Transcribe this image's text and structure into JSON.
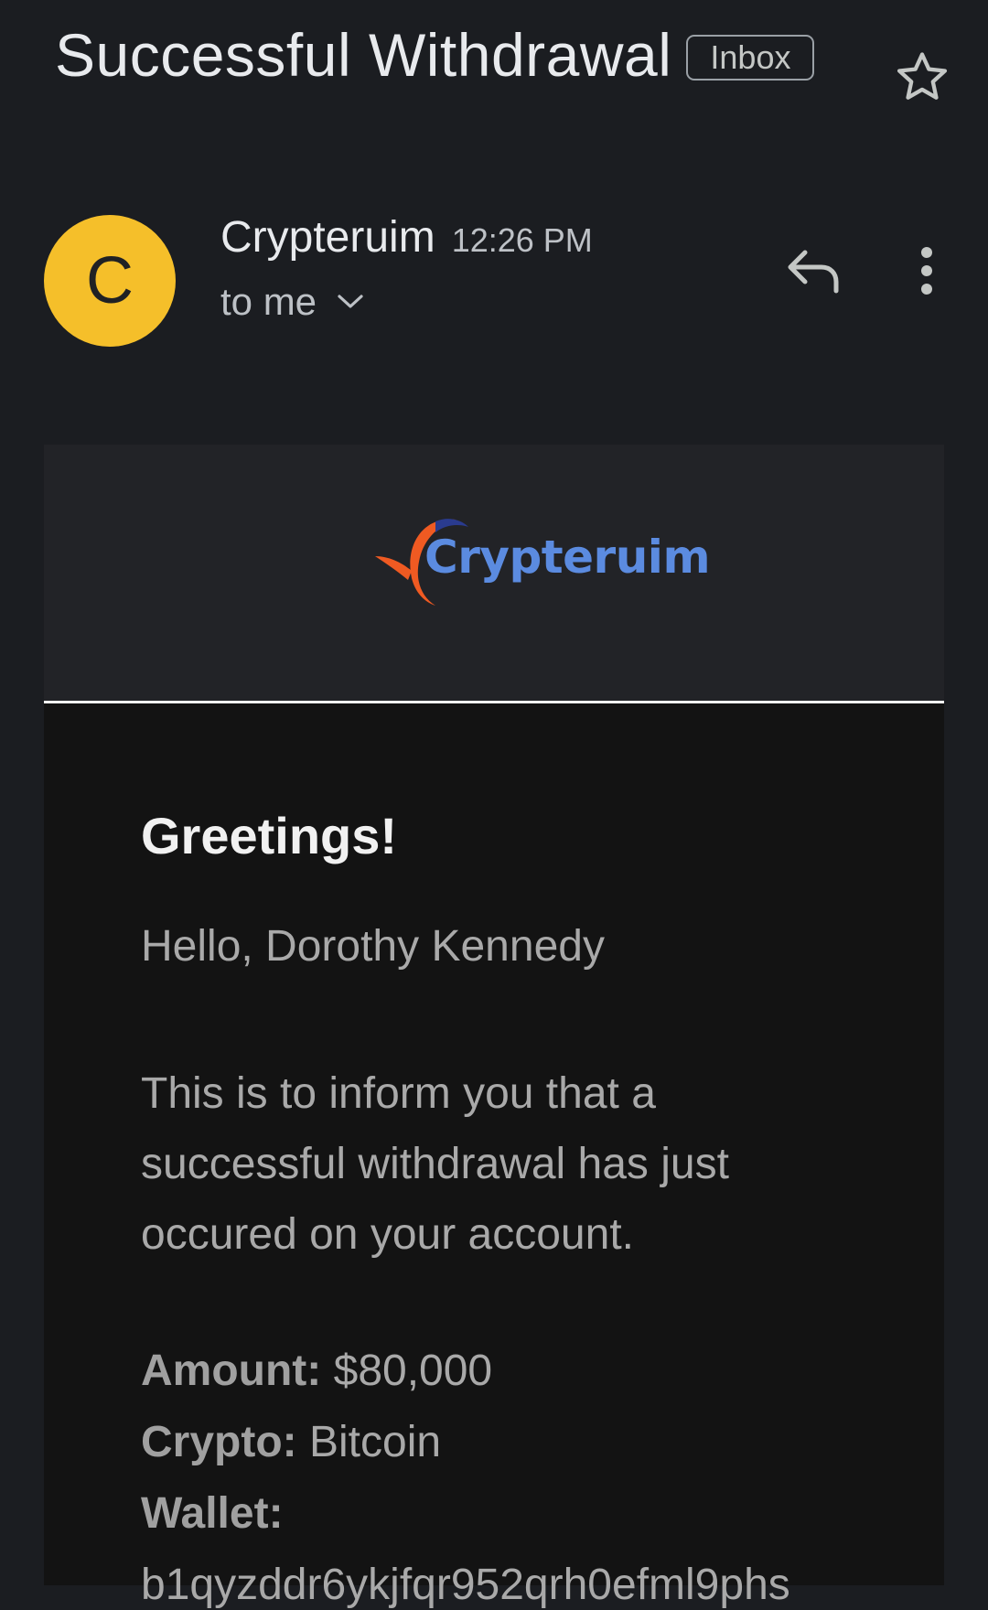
{
  "header": {
    "subject": "Successful Withdrawal",
    "label_chip": "Inbox",
    "star_icon": "star-outline-icon"
  },
  "sender": {
    "avatar_letter": "C",
    "avatar_color": "#f5bf2a",
    "name": "Crypteruim",
    "time": "12:26 PM",
    "recipient": "to me",
    "reply_icon": "reply-icon",
    "more_icon": "more-vertical-icon"
  },
  "email": {
    "logo_text": "Crypteruim",
    "logo_colors": {
      "text": "#5b8be0",
      "swoosh": "#ef5a22",
      "swoosh_dark": "#2a3b8f"
    },
    "greeting": "Greetings!",
    "hello": "Hello, Dorothy Kennedy",
    "message": "This is to inform you that a successful withdrawal has just occured on your account.",
    "amount_label": "Amount:",
    "amount_value": " $80,000",
    "crypto_label": "Crypto:",
    "crypto_value": " Bitcoin",
    "wallet_label": "Wallet:",
    "wallet_value": "b1qyzddr6ykjfqr952qrh0efml9phs"
  }
}
